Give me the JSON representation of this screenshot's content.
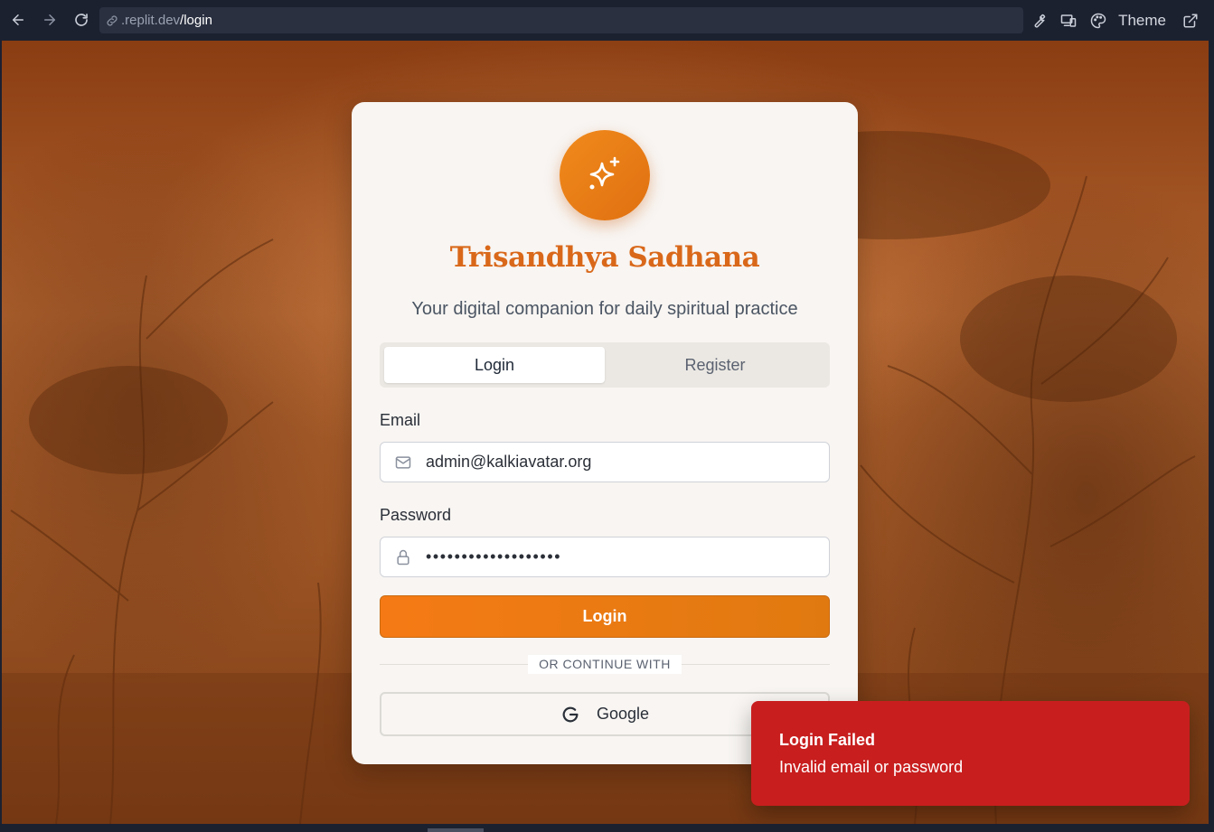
{
  "browser": {
    "url_host": ".replit.dev",
    "url_path": "/login",
    "theme_label": "Theme",
    "icons": [
      "back-arrow-icon",
      "forward-arrow-icon",
      "reload-icon",
      "link-icon",
      "wrench-icon",
      "devices-icon",
      "palette-icon",
      "external-link-icon"
    ]
  },
  "card": {
    "logo_icon": "sparkles-icon",
    "title": "Trisandhya Sadhana",
    "subtitle": "Your digital companion for daily spiritual practice",
    "tabs": [
      {
        "label": "Login",
        "active": true
      },
      {
        "label": "Register",
        "active": false
      }
    ],
    "email": {
      "label": "Email",
      "value": "admin@kalkiavatar.org",
      "icon": "mail-icon"
    },
    "password": {
      "label": "Password",
      "masked_value": "•••••••••••••••••••",
      "icon": "lock-icon"
    },
    "login_button": "Login",
    "divider_text": "OR CONTINUE WITH",
    "google_button": "Google"
  },
  "toast": {
    "title": "Login Failed",
    "description": "Invalid email or password",
    "color": "#c81e1e"
  },
  "colors": {
    "accent": "#f57a15",
    "title": "#d9681a",
    "error": "#c81e1e"
  }
}
